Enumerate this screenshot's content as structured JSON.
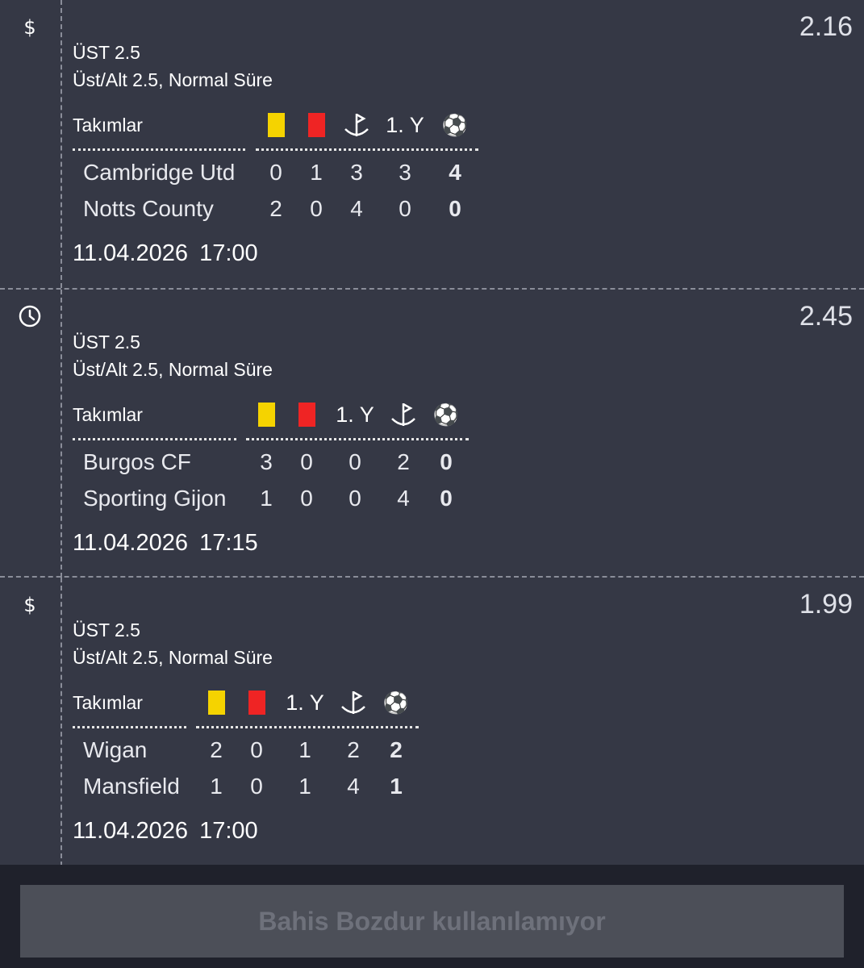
{
  "bets": [
    {
      "status_icon": "dollar-icon",
      "odds": "2.16",
      "market": "ÜST 2.5",
      "market_detail": "Üst/Alt 2.5, Normal Süre",
      "teams_header": "Takımlar",
      "columns": [
        {
          "type": "yellow-card-icon"
        },
        {
          "type": "red-card-icon"
        },
        {
          "type": "corner-flag-icon"
        },
        {
          "type": "first-half",
          "label": "1. Y"
        },
        {
          "type": "soccer-ball-icon",
          "label": "⚽"
        }
      ],
      "teams": [
        {
          "name": "Cambridge Utd",
          "stats": [
            "0",
            "1",
            "3",
            "3",
            "4"
          ]
        },
        {
          "name": "Notts County",
          "stats": [
            "2",
            "0",
            "4",
            "0",
            "0"
          ]
        }
      ],
      "date": "11.04.2026",
      "time": "17:00"
    },
    {
      "status_icon": "clock-icon",
      "odds": "2.45",
      "market": "ÜST 2.5",
      "market_detail": "Üst/Alt 2.5, Normal Süre",
      "teams_header": "Takımlar",
      "columns": [
        {
          "type": "yellow-card-icon"
        },
        {
          "type": "red-card-icon"
        },
        {
          "type": "first-half",
          "label": "1. Y"
        },
        {
          "type": "corner-flag-icon"
        },
        {
          "type": "soccer-ball-icon",
          "label": "⚽"
        }
      ],
      "teams": [
        {
          "name": "Burgos CF",
          "stats": [
            "3",
            "0",
            "0",
            "2",
            "0"
          ]
        },
        {
          "name": "Sporting Gijon",
          "stats": [
            "1",
            "0",
            "0",
            "4",
            "0"
          ]
        }
      ],
      "date": "11.04.2026",
      "time": "17:15"
    },
    {
      "status_icon": "dollar-icon",
      "odds": "1.99",
      "market": "ÜST 2.5",
      "market_detail": "Üst/Alt 2.5, Normal Süre",
      "teams_header": "Takımlar",
      "columns": [
        {
          "type": "yellow-card-icon"
        },
        {
          "type": "red-card-icon"
        },
        {
          "type": "first-half",
          "label": "1. Y"
        },
        {
          "type": "corner-flag-icon"
        },
        {
          "type": "soccer-ball-icon",
          "label": "⚽"
        }
      ],
      "teams": [
        {
          "name": "Wigan",
          "stats": [
            "2",
            "0",
            "1",
            "2",
            "2"
          ]
        },
        {
          "name": "Mansfield",
          "stats": [
            "1",
            "0",
            "1",
            "4",
            "1"
          ]
        }
      ],
      "date": "11.04.2026",
      "time": "17:00"
    }
  ],
  "colors": {
    "background": "#353845",
    "footer": "#1f212b",
    "yellow_card": "#f5d300",
    "red_card": "#ef2424",
    "button_disabled": "#4c4f58",
    "button_text_disabled": "#6e717b"
  },
  "footer": {
    "cashout_label": "Bahis Bozdur kullanılamıyor"
  }
}
